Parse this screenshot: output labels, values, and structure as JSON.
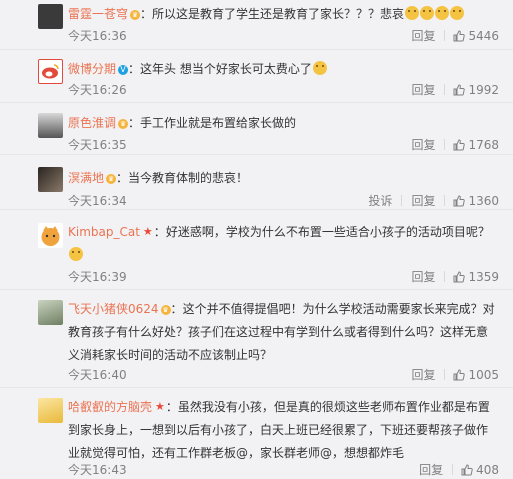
{
  "comments": [
    {
      "user": "雷霆一苍穹",
      "badge": "crown",
      "text": "所以这是教育了学生还是教育了家长？？？悲哀",
      "emojis": 4,
      "time": "今天16:36",
      "actions": [
        "回复"
      ],
      "likes": "5446",
      "avatar_color": "#3a3a3a"
    },
    {
      "user": "微博分期",
      "badge": "v",
      "text": "这年头 想当个好家长可太费心了",
      "emojis": 1,
      "time": "今天16:26",
      "actions": [
        "回复"
      ],
      "likes": "1992",
      "avatar_color": "#e24a3b"
    },
    {
      "user": "原色淮调",
      "badge": "crown",
      "text": "手工作业就是布置给家长做的",
      "emojis": 0,
      "time": "今天16:35",
      "actions": [
        "回复"
      ],
      "likes": "1768",
      "avatar_color": "#6b6b6b"
    },
    {
      "user": "溟满地",
      "badge": "crown",
      "text": "当今教育体制的悲哀！",
      "emojis": 0,
      "time": "今天16:34",
      "actions": [
        "投诉",
        "回复"
      ],
      "likes": "1360",
      "avatar_color": "#4a4038"
    },
    {
      "user": "Kimbap_Cat",
      "badge": "star",
      "text": "好迷惑啊，学校为什么不布置一些适合小孩子的活动项目呢？",
      "emojis": 1,
      "time": "今天16:39",
      "actions": [
        "回复"
      ],
      "likes": "1359",
      "avatar_color": "#f0a33c"
    },
    {
      "user": "飞天小猪侠0624",
      "badge": "crown",
      "text": "这个并不值得提倡吧！为什么学校活动需要家长来完成？对教育孩子有什么好处？孩子们在这过程中有学到什么或者得到什么吗？这样无意义消耗家长时间的活动不应该制止吗？",
      "emojis": 0,
      "time": "今天16:40",
      "actions": [
        "回复"
      ],
      "likes": "1005",
      "avatar_color": "#7a8a6a"
    },
    {
      "user": "哈叡叡的方脑壳",
      "badge": "star",
      "text": "虽然我没有小孩，但是真的很烦这些老师布置作业都是布置到家长身上，一想到以后有小孩了，白天上班已经很累了，下班还要帮孩子做作业就觉得可怕，还有工作群老板@，家长群老师@，想想都炸毛",
      "emojis": 0,
      "time": "今天16:43",
      "actions": [
        "回复"
      ],
      "likes": "408",
      "avatar_color": "#f2d35a"
    }
  ]
}
